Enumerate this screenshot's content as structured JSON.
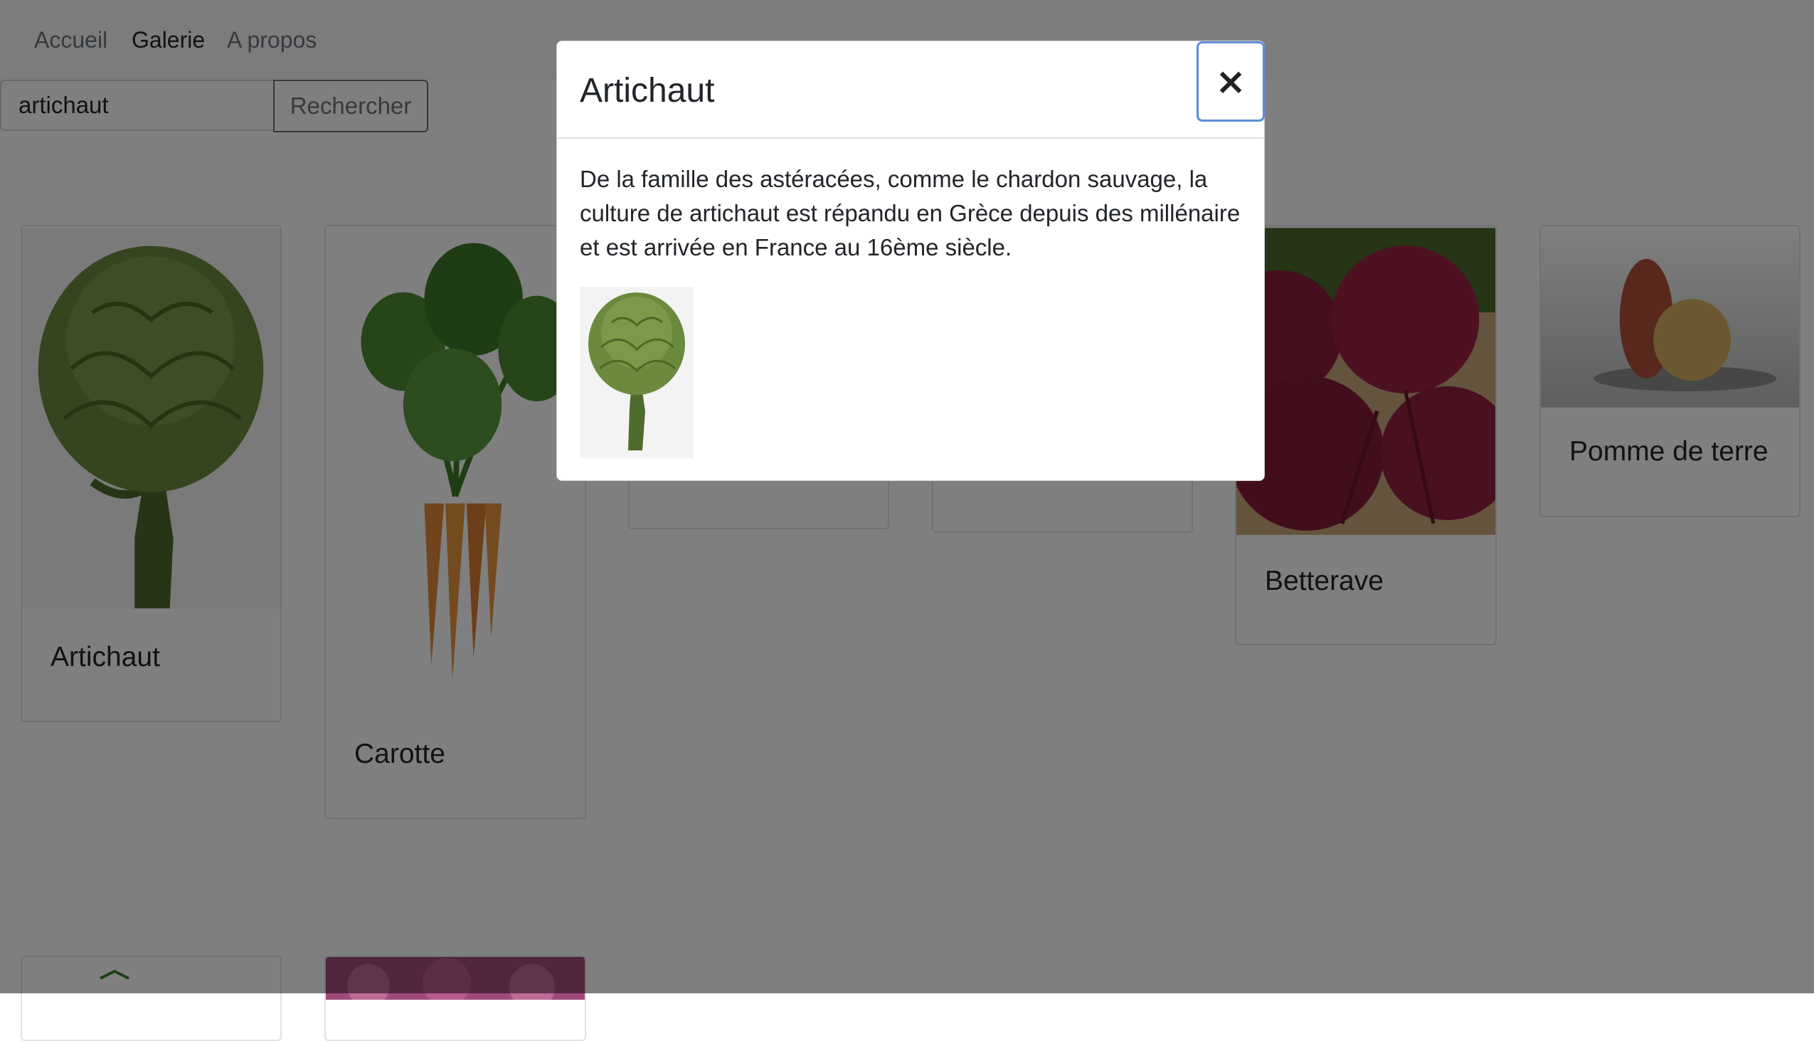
{
  "nav": {
    "items": [
      {
        "label": "Accueil"
      },
      {
        "label": "Galerie"
      },
      {
        "label": "A propos"
      }
    ]
  },
  "search": {
    "value": "artichaut",
    "button_label": "Rechercher"
  },
  "cards": [
    {
      "title": "Artichaut"
    },
    {
      "title": "Carotte"
    },
    {
      "title": "Betterave"
    },
    {
      "title": "Pomme de terre"
    }
  ],
  "modal": {
    "title": "Artichaut",
    "close_label": "×",
    "description": "De la famille des astéracées, comme le chardon sauvage, la culture de artichaut est répandu en Grèce depuis des millénaire et est arrivée en France au 16ème siècle."
  },
  "colors": {
    "backdrop": "rgba(0,0,0,0.5)",
    "close_focus_ring": "#5b8ed8"
  }
}
